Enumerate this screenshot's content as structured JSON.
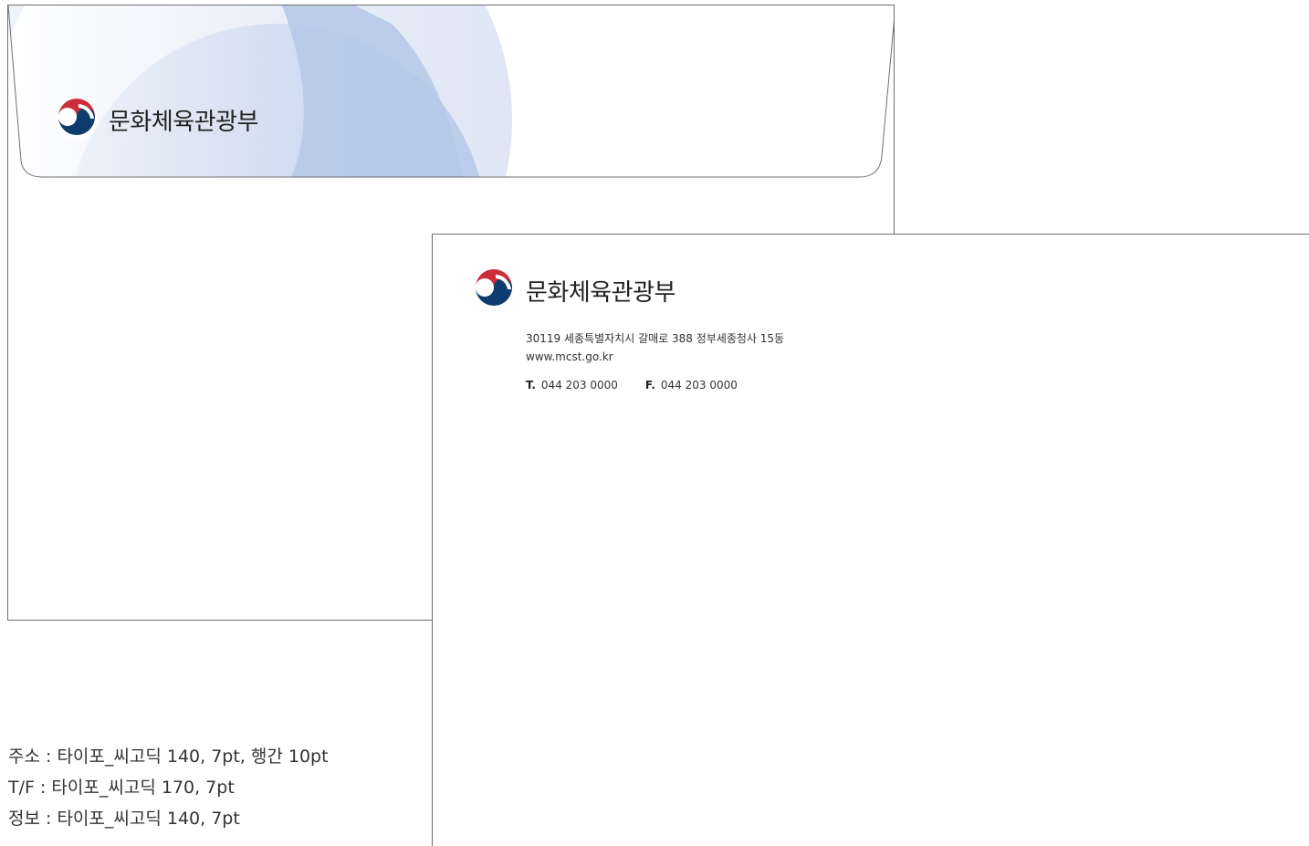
{
  "brand": {
    "name": "문화체육관광부",
    "emblem_colors": {
      "red": "#cd2e3a",
      "blue": "#0f3c6e",
      "white": "#ffffff"
    }
  },
  "front": {
    "address": "30119 세종특별자치시 갈매로 388 정부세종청사 15동",
    "website": "www.mcst.go.kr",
    "tel_label": "T.",
    "tel": "044 203 0000",
    "fax_label": "F.",
    "fax": "044 203 0000"
  },
  "spec_notes": [
    "주소 : 타이포_씨고딕 140, 7pt, 행간 10pt",
    "T/F : 타이포_씨고딕 170, 7pt",
    "정보 : 타이포_씨고딕 140, 7pt"
  ],
  "colors": {
    "flap_light": "#e9eef8",
    "flap_mid": "#b7cae9",
    "border": "#6f6f6f"
  }
}
